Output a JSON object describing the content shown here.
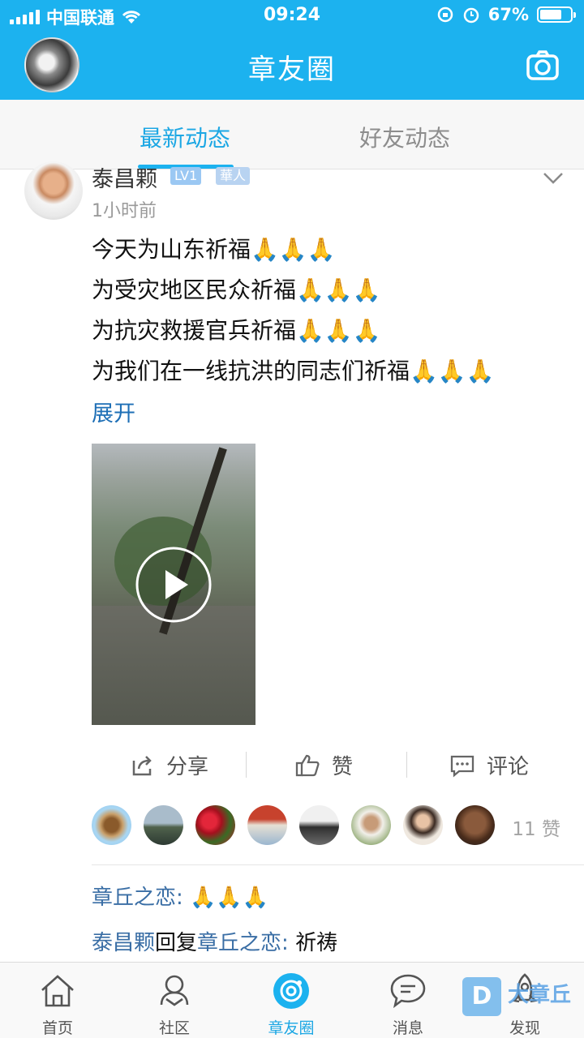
{
  "status_bar": {
    "carrier": "中国联通",
    "time": "09:24",
    "battery_percent": "67%",
    "battery_level": 0.67
  },
  "header": {
    "title": "章友圈"
  },
  "tabs": [
    {
      "label": "最新动态",
      "active": true
    },
    {
      "label": "好友动态",
      "active": false
    }
  ],
  "post": {
    "author": "泰昌颗",
    "level_badge": "LV1",
    "tag_badge": "華人",
    "time_ago": "1小时前",
    "lines": [
      {
        "text": "今天为山东祈福",
        "emoji": "🙏🙏🙏"
      },
      {
        "text": "为受灾地区民众祈福",
        "emoji": "🙏🙏🙏"
      },
      {
        "text": "为抗灾救援官兵祈福",
        "emoji": "🙏🙏🙏"
      },
      {
        "text": "为我们在一线抗洪的同志们祈福",
        "emoji": "🙏🙏🙏"
      }
    ],
    "expand_label": "展开",
    "actions": {
      "share": "分享",
      "like": "赞",
      "comment": "评论"
    },
    "like_count_label": "11 赞",
    "comments": [
      {
        "author": "章丘之恋",
        "sep": ": ",
        "text": "🙏🙏🙏"
      },
      {
        "author": "泰昌颗",
        "reply_word": "回复",
        "target": "章丘之恋",
        "sep": ": ",
        "text": "祈祷"
      }
    ]
  },
  "bottom_nav": [
    {
      "label": "首页",
      "icon": "home-icon"
    },
    {
      "label": "社区",
      "icon": "community-icon"
    },
    {
      "label": "章友圈",
      "icon": "circle-icon",
      "active": true
    },
    {
      "label": "消息",
      "icon": "message-icon"
    },
    {
      "label": "发现",
      "icon": "rocket-icon"
    }
  ],
  "watermark": {
    "logo_letter": "D",
    "text": "大章丘"
  },
  "colors": {
    "header": "#1cb2ef",
    "active": "#1ca7e4",
    "link": "#3a6ea5"
  }
}
